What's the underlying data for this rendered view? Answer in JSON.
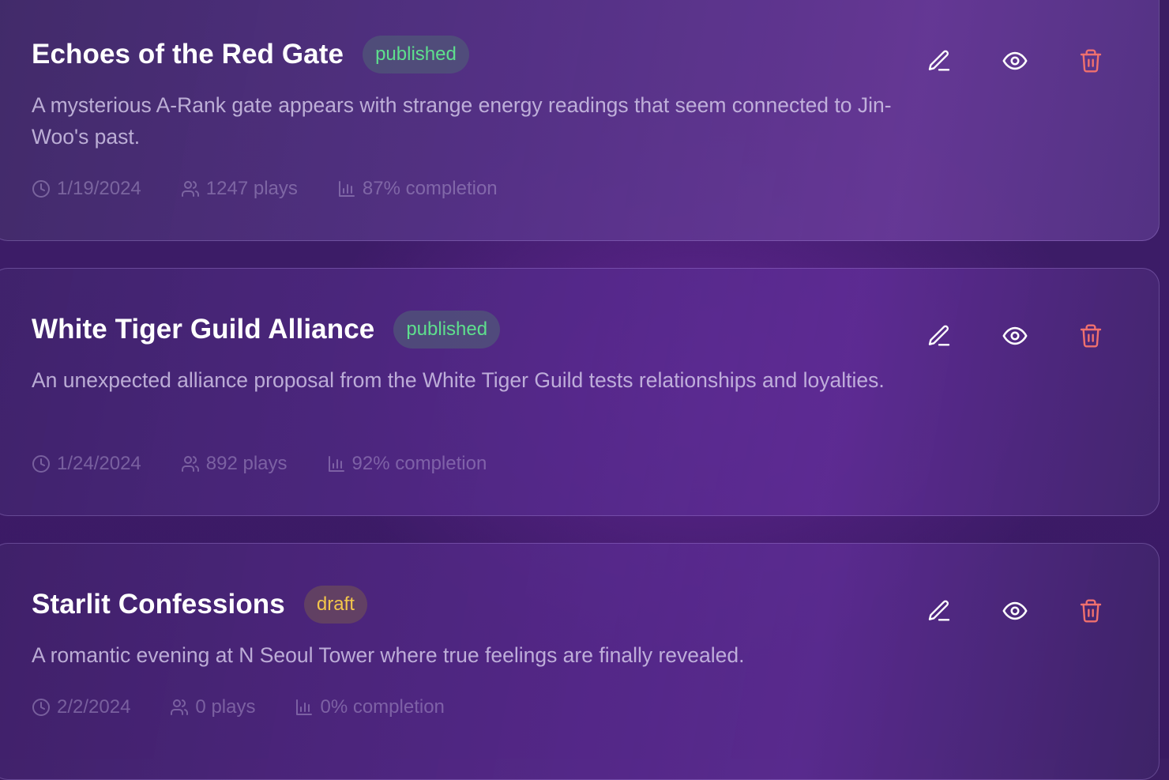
{
  "stories": [
    {
      "title": "Echoes of the Red Gate",
      "status": "published",
      "description": "A mysterious A-Rank gate appears with strange energy readings that seem connected to Jin-Woo's past.",
      "date": "1/19/2024",
      "plays": "1247 plays",
      "completion": "87% completion"
    },
    {
      "title": "White Tiger Guild Alliance",
      "status": "published",
      "description": "An unexpected alliance proposal from the White Tiger Guild tests relationships and loyalties.",
      "date": "1/24/2024",
      "plays": "892 plays",
      "completion": "92% completion"
    },
    {
      "title": "Starlit Confessions",
      "status": "draft",
      "description": "A romantic evening at N Seoul Tower where true feelings are finally revealed.",
      "date": "2/2/2024",
      "plays": "0 plays",
      "completion": "0% completion"
    }
  ],
  "icons": {
    "date": "clock-icon",
    "plays": "users-icon",
    "completion": "bar-chart-icon",
    "edit": "pencil-icon",
    "view": "eye-icon",
    "delete": "trash-icon"
  },
  "colors": {
    "published": "#5ee08d",
    "draft": "#f4c64a",
    "delete": "#f0706e"
  }
}
